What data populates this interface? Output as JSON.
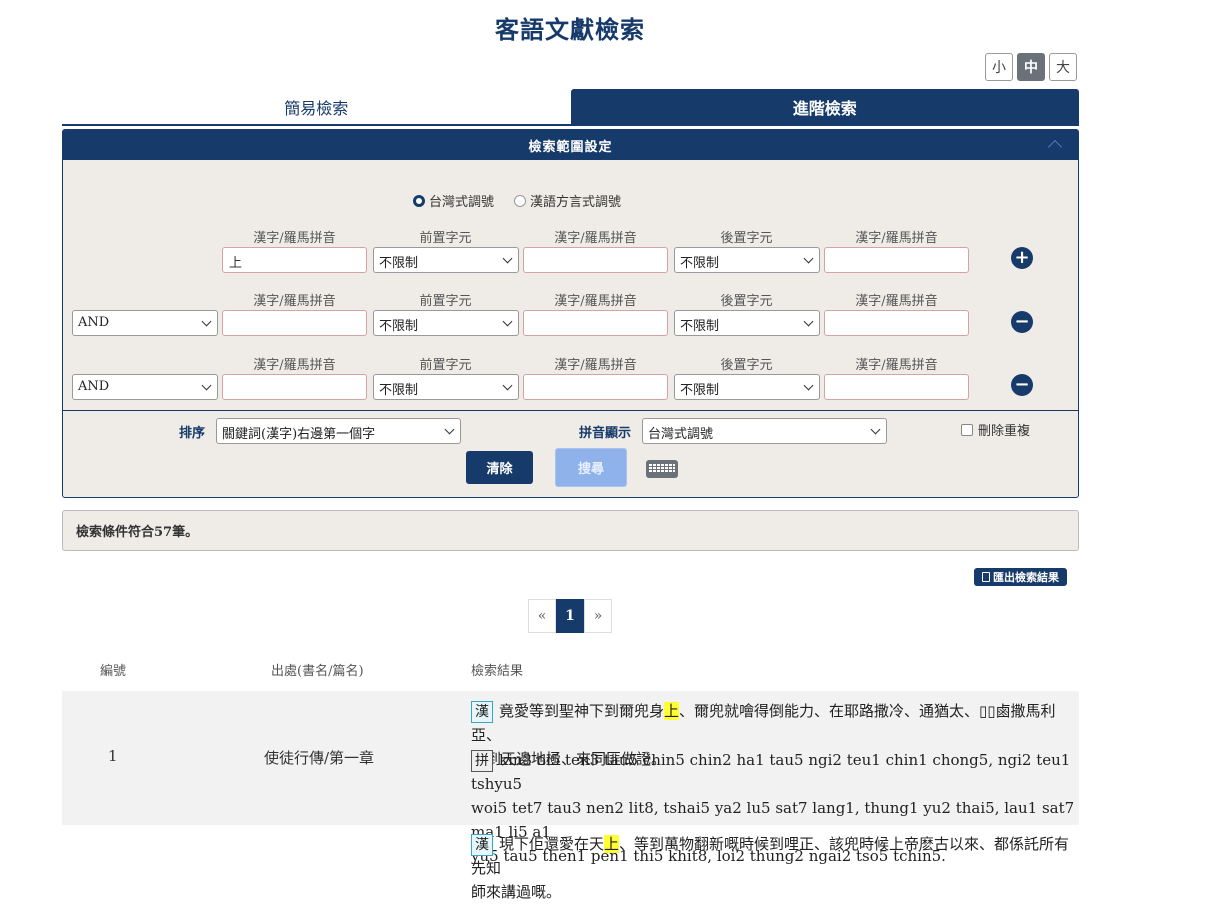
{
  "page_title": "客語文獻檢索",
  "font_sizes": [
    "小",
    "中",
    "大"
  ],
  "tabs": [
    {
      "label": "簡易檢索",
      "active": false
    },
    {
      "label": "進階檢索",
      "active": true
    }
  ],
  "panel": {
    "title": "檢索範圍設定",
    "radios": [
      {
        "label": "台灣式調號",
        "checked": true
      },
      {
        "label": "漢語方言式調號",
        "checked": false
      }
    ],
    "col_labels": [
      "漢字/羅馬拼音",
      "前置字元",
      "漢字/羅馬拼音",
      "後置字元",
      "漢字/羅馬拼音"
    ],
    "rows": [
      {
        "op": "",
        "text1": "上",
        "pre": "不限制",
        "text2": "",
        "post": "不限制",
        "text3": "",
        "action": "+"
      },
      {
        "op": "AND",
        "text1": "",
        "pre": "不限制",
        "text2": "",
        "post": "不限制",
        "text3": "",
        "action": "−"
      },
      {
        "op": "AND",
        "text1": "",
        "pre": "不限制",
        "text2": "",
        "post": "不限制",
        "text3": "",
        "action": "−"
      }
    ],
    "sort_label": "排序",
    "sort_value": "關鍵詞(漢字)右邊第一個字",
    "pinyin_label": "拼音顯示",
    "pinyin_value": "台灣式調號",
    "dedupe_label": "刪除重複",
    "clear_label": "清除",
    "search_label": "搜尋"
  },
  "result_summary": "檢索條件符合57筆。",
  "export_label": "匯出檢索結果",
  "pager": {
    "prev": "«",
    "current": "1",
    "next": "»"
  },
  "table": {
    "headers": [
      "編號",
      "出處(書名/篇名)",
      "檢索結果"
    ],
    "rows": [
      {
        "no": "1",
        "source": "使徒行傳/第一章",
        "han_badge": "漢",
        "han_line1_a": "竟愛等到聖神下到爾兜身",
        "han_hl": "上",
        "han_line1_b": "、爾兜就噲得倒能力、在耶路撒冷、通猶太、▯▯鹵撒馬利亞、",
        "han_line2": "又到天邊地極、來同匪做證。",
        "pin_badge": "拼",
        "pin_line1": "kin3 oi5 ten3 tau5 chin5 chin2 ha1 tau5 ngi2 teu1 chin1 chong5, ngi2 teu1 tshyu5",
        "pin_line2": "woi5 tet7 tau3 nen2 lit8, tshai5 ya2 lu5 sat7 lang1, thung1 yu2 thai5, lau1 sat7 ma1 li5 a1",
        "pin_line3": "yu5 tau5 then1 pen1 thi5 khit8, loi2 thung2 ngai2 tso5 tchin5."
      },
      {
        "han_badge": "漢",
        "han_line1_a": "現下佢還愛在天",
        "han_hl": "上",
        "han_line1_b": "、等到萬物翻新嘅時候到哩正、該兜時候上帝麽古以來、都係託所有先知",
        "han_line2": "師來講過嘅。"
      }
    ]
  }
}
